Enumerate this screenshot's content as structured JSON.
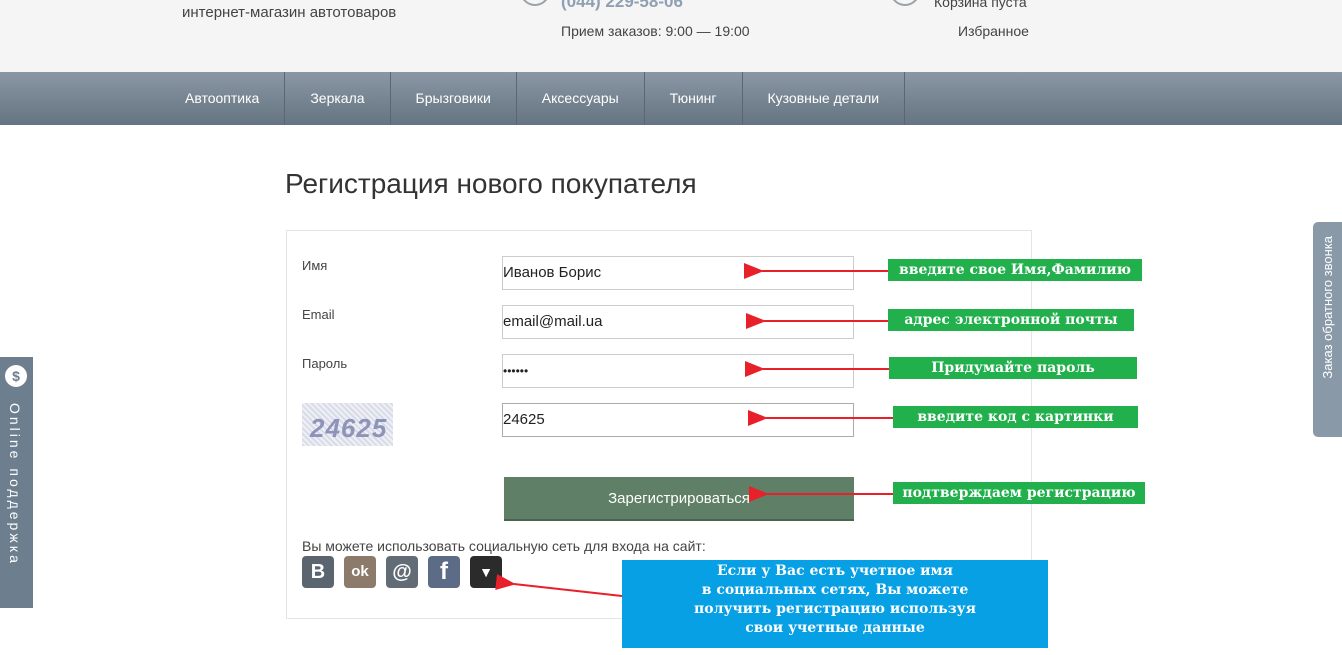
{
  "header": {
    "tagline": "интернет-магазин автотоваров",
    "phone": "(044) 229-58-06",
    "hours": "Прием заказов: 9:00 — 19:00",
    "cart": "Корзина пуста",
    "favorites": "Избранное"
  },
  "nav": [
    "Автооптика",
    "Зеркала",
    "Брызговики",
    "Аксессуары",
    "Тюнинг",
    "Кузовные детали"
  ],
  "page_title": "Регистрация нового покупателя",
  "form": {
    "name_label": "Имя",
    "name_value": "Иванов Борис",
    "email_label": "Email",
    "email_value": "email@mail.ua",
    "password_label": "Пароль",
    "password_value": "••••••",
    "captcha_text": "24625",
    "captcha_value": "24625",
    "submit_label": "Зарегистрироваться",
    "social_text": "Вы можете использовать социальную сеть для входа на сайт:"
  },
  "social": [
    {
      "name": "vk-icon",
      "glyph": "В",
      "color": "#5b6570"
    },
    {
      "name": "odnoklassniki-icon",
      "glyph": "ok",
      "color": "#8c7a6a"
    },
    {
      "name": "mailru-icon",
      "glyph": "@",
      "color": "#626c76"
    },
    {
      "name": "facebook-icon",
      "glyph": "f",
      "color": "#5c6c86"
    },
    {
      "name": "more-dropdown-icon",
      "glyph": "▼",
      "color": "#2b2b2b"
    }
  ],
  "annotations": {
    "name_hint": "введите свое Имя,Фамилию",
    "email_hint": "адрес электронной почты",
    "password_hint": "Придумайте пароль",
    "captcha_hint": "введите код с  картинки",
    "submit_hint": "подтверждаем регистрацию",
    "social_hint_1": "Если у Вас есть учетное имя",
    "social_hint_2": "в социальных сетях, Вы можете",
    "social_hint_3": "получить регистрацию используя",
    "social_hint_4": "свои учетные данные"
  },
  "side": {
    "online_icon": "$",
    "online": "Online поддержка",
    "callback": "Заказ обратного звонка"
  },
  "colors": {
    "annotation_green": "#22b04d",
    "annotation_blue": "#08a0e4",
    "arrow_red": "#e8202a",
    "submit": "#5f7f66"
  }
}
